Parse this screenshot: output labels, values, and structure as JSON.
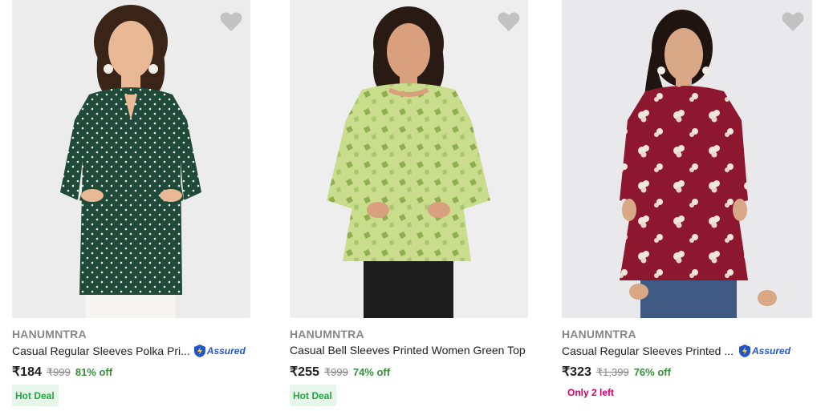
{
  "products": [
    {
      "brand": "HANUMNTRA",
      "title": "Casual Regular Sleeves Polka Pri...",
      "assured_label": "Assured",
      "price": "₹184",
      "mrp": "₹999",
      "discount": "81% off",
      "tag": "Hot Deal",
      "image_icon": "green-polka-dot-top-photo",
      "top_color": "#1f4a3a"
    },
    {
      "brand": "HANUMNTRA",
      "title": "Casual Bell Sleeves Printed Women Green Top",
      "price": "₹255",
      "mrp": "₹999",
      "discount": "74% off",
      "tag": "Hot Deal",
      "image_icon": "lime-green-printed-top-photo",
      "top_color": "#c9dd8c"
    },
    {
      "brand": "HANUMNTRA",
      "title": "Casual Regular Sleeves Printed ...",
      "assured_label": "Assured",
      "price": "₹323",
      "mrp": "₹1,399",
      "discount": "76% off",
      "stock_note": "Only 2 left",
      "image_icon": "maroon-floral-top-photo",
      "top_color": "#8e1730"
    }
  ],
  "colors": {
    "brand_text": "#878787",
    "discount": "#388e3c",
    "hot_deal_bg": "#e6f6ea",
    "hot_deal_text": "#26a541",
    "stock_warning": "#d6006f",
    "assured_blue": "#2455c8",
    "wishlist_heart": "#c2c2c2"
  }
}
